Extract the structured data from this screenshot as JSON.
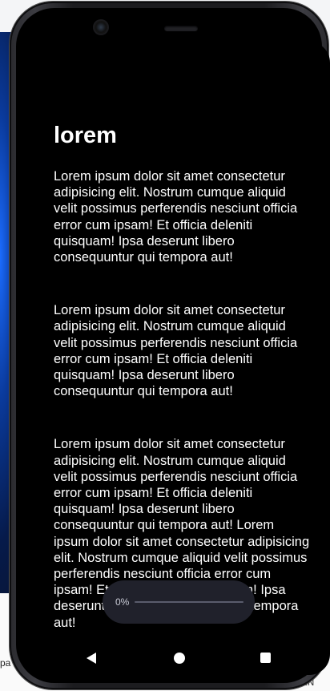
{
  "background": {
    "left_text": "pa",
    "right_text": "DEN"
  },
  "page": {
    "title": "lorem",
    "paragraphs": [
      "Lorem ipsum dolor sit amet consectetur adipisicing elit. Nostrum cumque aliquid velit possimus perferendis nesciunt officia error cum ipsam! Et officia deleniti quisquam! Ipsa deserunt libero consequuntur qui tempora aut!",
      "Lorem ipsum dolor sit amet consectetur adipisicing elit. Nostrum cumque aliquid velit possimus perferendis nesciunt officia error cum ipsam! Et officia deleniti quisquam! Ipsa deserunt libero consequuntur qui tempora aut!",
      "Lorem ipsum dolor sit amet consectetur adipisicing elit. Nostrum cumque aliquid velit possimus perferendis nesciunt officia error cum ipsam! Et officia deleniti quisquam! Ipsa deserunt libero consequuntur qui tempora aut! Lorem ipsum dolor sit amet consectetur adipisicing elit. Nostrum cumque aliquid velit possimus perferendis nesciunt officia error cum ipsam! Et officia deleniti quisquam! Ipsa deserunt libero consequuntur qui tempora aut!"
    ]
  },
  "progress": {
    "label": "0%",
    "value": 0
  },
  "nav": {
    "back": "back-icon",
    "home": "home-icon",
    "recents": "recents-icon"
  },
  "colors": {
    "screen_bg": "#000000",
    "text": "#ffffff",
    "pill_bg": "#20212b",
    "accent_blue": "#1b6cff"
  }
}
